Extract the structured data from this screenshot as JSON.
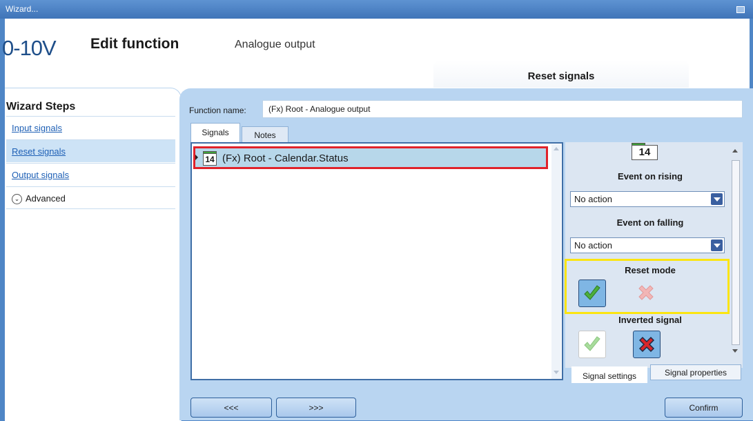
{
  "window": {
    "title": "Wizard..."
  },
  "header": {
    "icon_text": "0-10V",
    "title": "Edit function",
    "subtitle": "Analogue output",
    "active_step_tab": "Reset signals"
  },
  "sidebar": {
    "heading": "Wizard Steps",
    "items": [
      {
        "label": "Input signals"
      },
      {
        "label": "Reset signals"
      },
      {
        "label": "Output signals"
      },
      {
        "label": "Advanced"
      }
    ]
  },
  "main": {
    "function_name_label": "Function name:",
    "function_name_value": "(Fx) Root - Analogue output",
    "tabs": [
      {
        "label": "Signals"
      },
      {
        "label": "Notes"
      }
    ],
    "signals": [
      {
        "icon_text": "14",
        "label": "(Fx) Root - Calendar.Status"
      }
    ]
  },
  "settings": {
    "icon_text": "14",
    "event_rising_label": "Event on rising",
    "event_rising_value": "No action",
    "event_falling_label": "Event on falling",
    "event_falling_value": "No action",
    "reset_mode_label": "Reset mode",
    "inverted_signal_label": "Inverted signal",
    "tabs": [
      {
        "label": "Signal settings"
      },
      {
        "label": "Signal properties"
      }
    ]
  },
  "footer": {
    "prev_label": "<<<",
    "next_label": ">>>",
    "confirm_label": "Confirm"
  },
  "colors": {
    "accent": "#4f86c6",
    "panel": "#b9d5f1",
    "selection_highlight": "#e0222a",
    "reset_highlight": "#fbe510"
  }
}
